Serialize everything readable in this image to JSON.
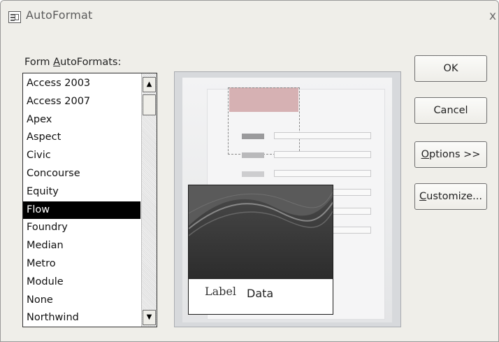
{
  "window": {
    "title": "AutoFormat",
    "close_label": "x"
  },
  "list": {
    "label_prefix": "Form ",
    "label_underlined": "A",
    "label_rest": "utoFormats:",
    "items": [
      "Access 2003",
      "Access 2007",
      "Apex",
      "Aspect",
      "Civic",
      "Concourse",
      "Equity",
      "Flow",
      "Foundry",
      "Median",
      "Metro",
      "Module",
      "None",
      "Northwind"
    ],
    "selected": "Flow"
  },
  "preview": {
    "label_text": "Label",
    "data_text": "Data"
  },
  "buttons": {
    "ok": "OK",
    "cancel": "Cancel",
    "options_underlined": "O",
    "options_rest": "ptions >>",
    "customize_underlined": "C",
    "customize_rest": "ustomize..."
  },
  "colors": {
    "dialog_bg": "#efeee9",
    "selection_bg": "#000000",
    "preview_header": "#d6b1b3",
    "card_dark": "#3b3b3b"
  },
  "icons": {
    "app": "autoformat-icon",
    "close": "close-icon",
    "scroll_up": "arrow-up-icon",
    "scroll_down": "arrow-down-icon"
  }
}
